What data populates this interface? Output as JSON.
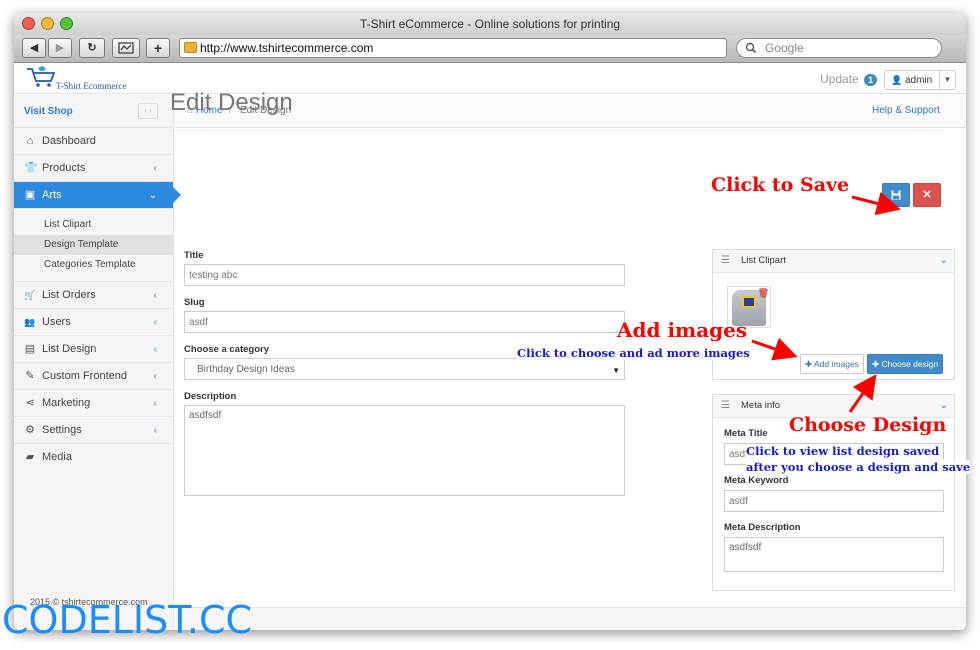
{
  "browser": {
    "window_title": "T-Shirt eCommerce - Online solutions for printing",
    "url": "http://www.tshirtecommerce.com",
    "search_placeholder": "Google",
    "back_label": "◀",
    "forward_label": "▶",
    "reload_label": "↻",
    "new_tab_label": "+"
  },
  "header": {
    "logo_text": "T-Shirt Ecommerce",
    "update_label": "Update",
    "update_count": "1",
    "user_label": "admin"
  },
  "sidebar": {
    "visit_shop": "Visit Shop",
    "items": [
      {
        "label": "Dashboard",
        "icon": "home-icon",
        "glyph": "⌂"
      },
      {
        "label": "Products",
        "icon": "tshirt-icon",
        "glyph": "👕"
      },
      {
        "label": "Arts",
        "icon": "image-icon",
        "glyph": "▣"
      },
      {
        "label": "List Orders",
        "icon": "cart-icon",
        "glyph": "🛒"
      },
      {
        "label": "Users",
        "icon": "users-icon",
        "glyph": "👥"
      },
      {
        "label": "List Design",
        "icon": "list-icon",
        "glyph": "▤"
      },
      {
        "label": "Custom Frontend",
        "icon": "brush-icon",
        "glyph": "✎"
      },
      {
        "label": "Marketing",
        "icon": "share-icon",
        "glyph": "⋖"
      },
      {
        "label": "Settings",
        "icon": "gear-icon",
        "glyph": "⚙"
      },
      {
        "label": "Media",
        "icon": "folder-icon",
        "glyph": "▰"
      }
    ],
    "arts_sub": [
      "List Clipart",
      "Design Template",
      "Categories Template"
    ]
  },
  "breadcrumb": {
    "home": "Home",
    "separator": "/",
    "current": "Edit Design",
    "help": "Help & Support"
  },
  "page": {
    "title": "Edit Design"
  },
  "form": {
    "title_label": "Title",
    "title_value": "testing abc",
    "slug_label": "Slug",
    "slug_value": "asdf",
    "category_label": "Choose a category",
    "category_value": "Birthday Design Ideas",
    "description_label": "Description",
    "description_value": "asdfsdf"
  },
  "clipart_panel": {
    "heading": "List Clipart",
    "add_images": "Add images",
    "choose_design": "Choose design"
  },
  "meta_panel": {
    "heading": "Meta info",
    "meta_title_label": "Meta Title",
    "meta_title_value": "asdf",
    "meta_keyword_label": "Meta Keyword",
    "meta_keyword_value": "asdf",
    "meta_description_label": "Meta Description",
    "meta_description_value": "asdfsdf"
  },
  "footer": {
    "copyright": "2015 © tshirtecommerce.com"
  },
  "annotations": {
    "click_to_save": "Click to Save",
    "add_images": "Add images",
    "add_images_hint": "Click to choose and ad more images",
    "choose_design": "Choose Design",
    "choose_design_hint_1": "Click to view list design saved",
    "choose_design_hint_2": "after you choose a design and save"
  },
  "watermark": "CODELIST.CC",
  "colors": {
    "accent": "#2d89de",
    "primary_button": "#428bca",
    "danger_button": "#d9534f",
    "annotation_red": "#ff0000",
    "annotation_blue": "#1717d6",
    "watermark": "#1a8dff"
  }
}
